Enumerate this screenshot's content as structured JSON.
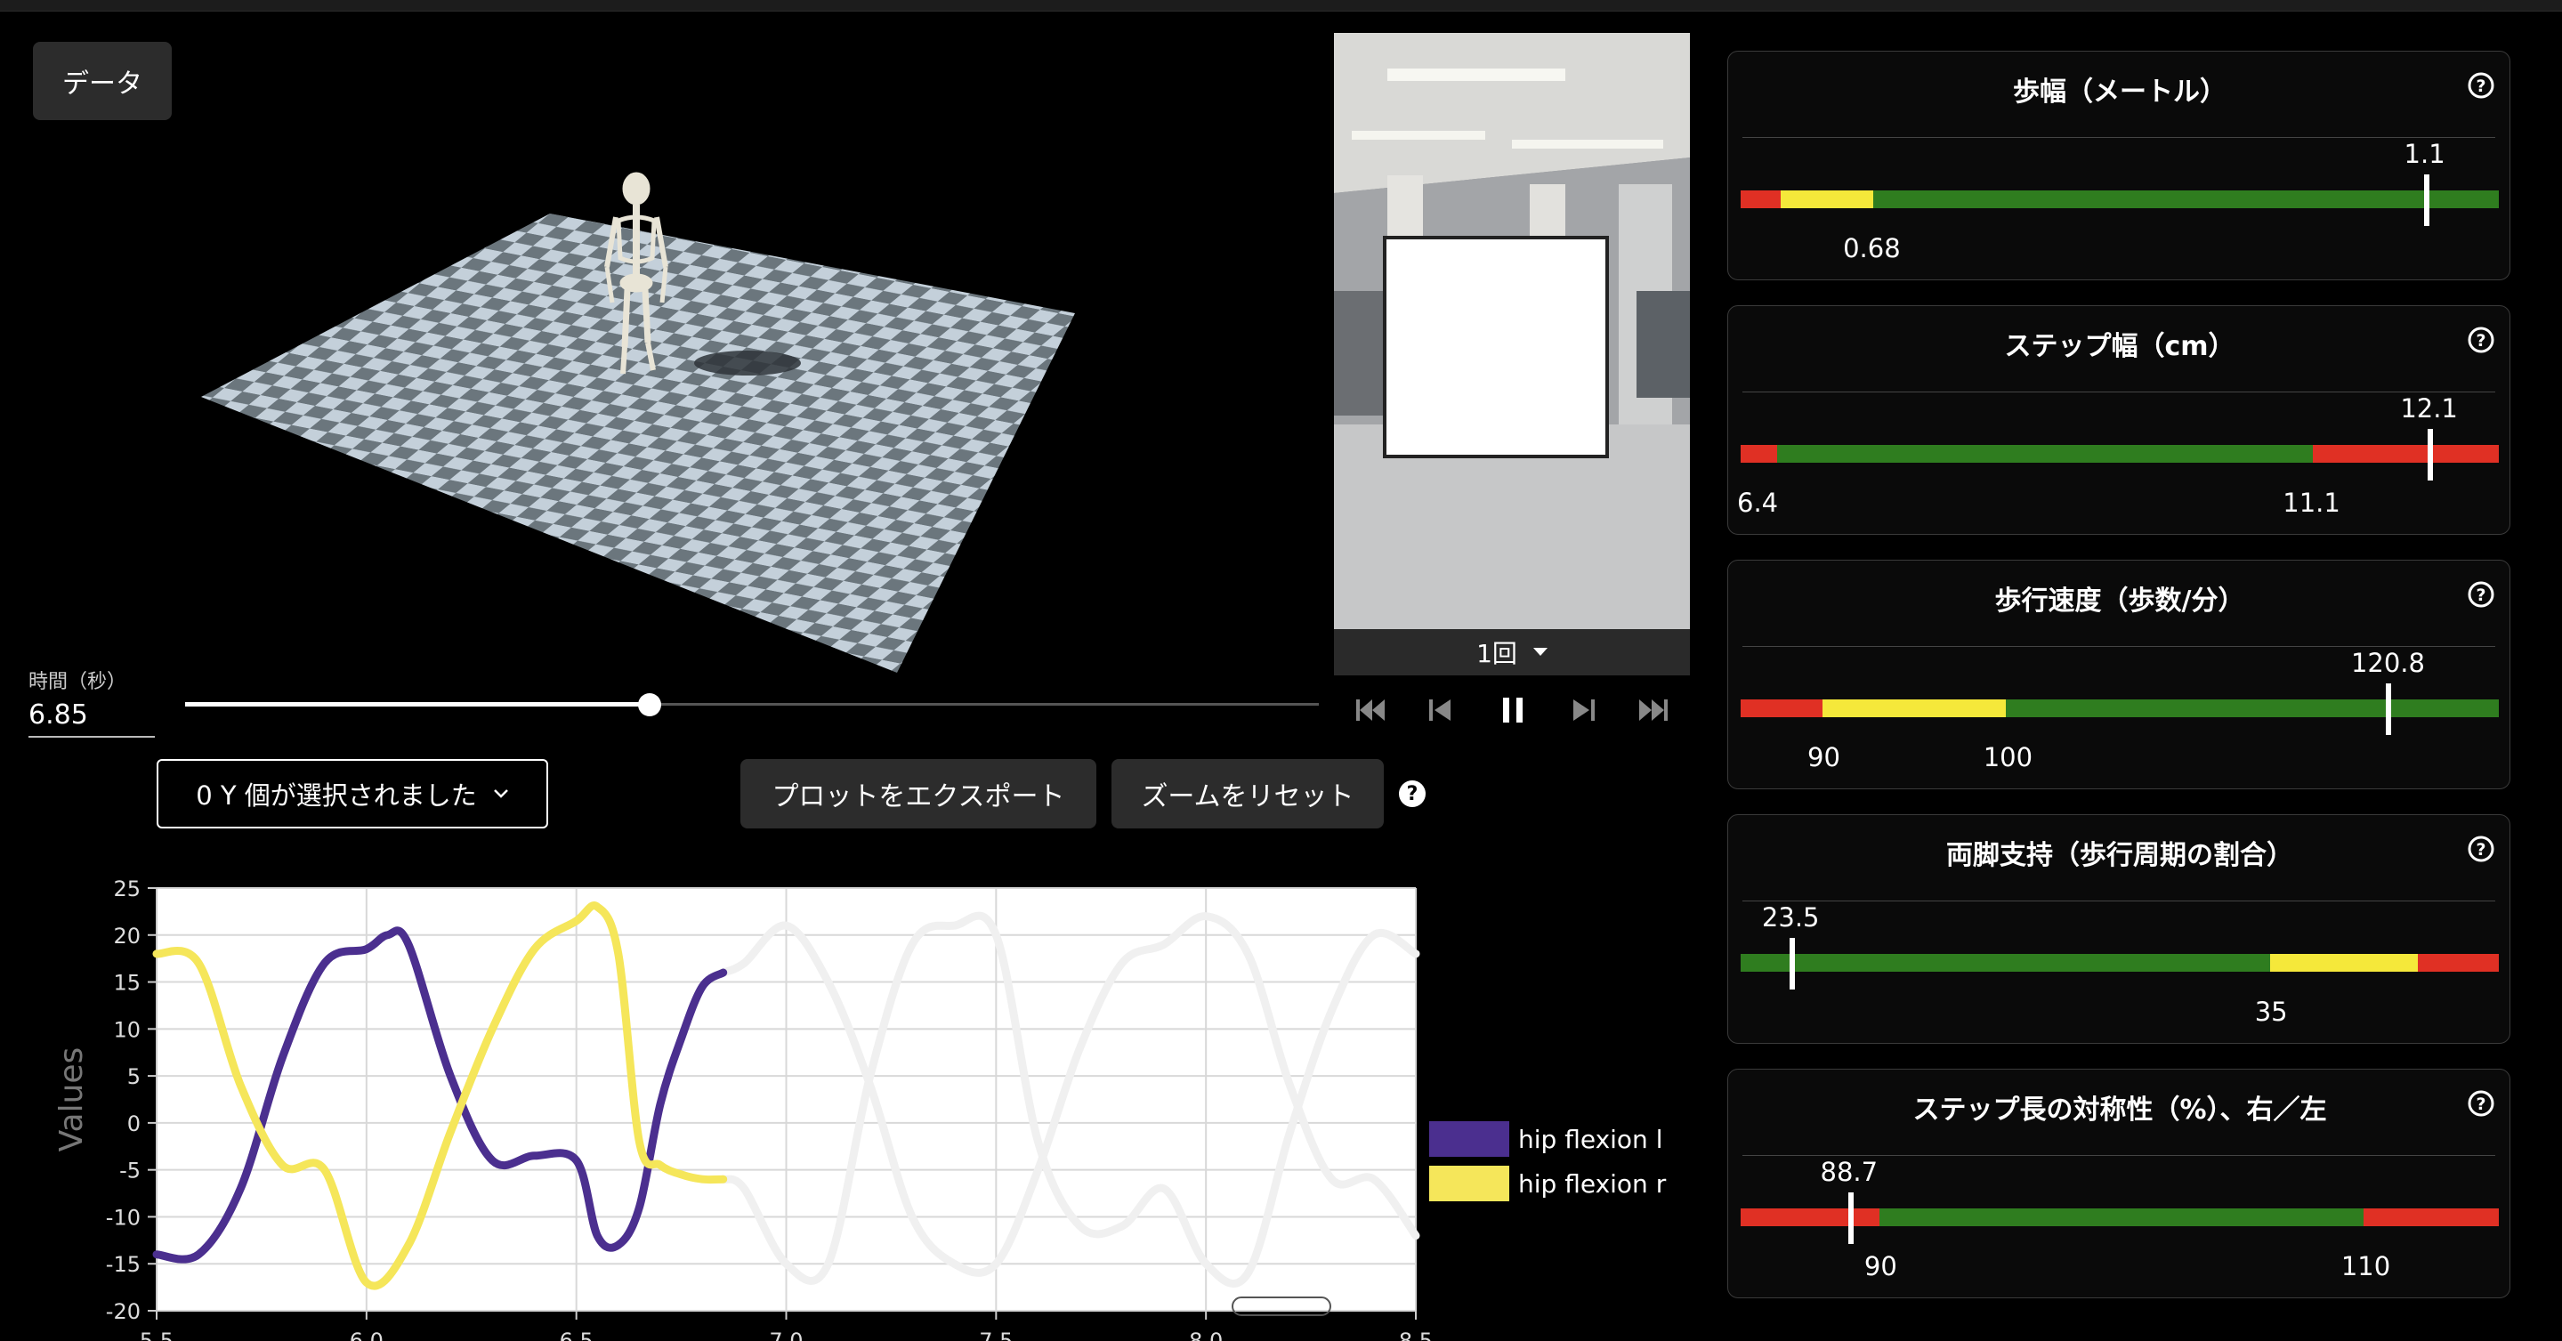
{
  "data_button": "データ",
  "time": {
    "label": "時間（秒）",
    "value": "6.85"
  },
  "playback": {
    "repeat": "1回",
    "progress": 0.41
  },
  "select": {
    "label": "0 Y 個が選択されました"
  },
  "buttons": {
    "export": "プロットをエクスポート",
    "reset_zoom": "ズームをリセット",
    "help": "?"
  },
  "chart_data": {
    "type": "line",
    "ylabel": "Values",
    "xlim": [
      5.5,
      8.5
    ],
    "ylim": [
      -20,
      25
    ],
    "x_ticks": [
      "5.5",
      "6.0",
      "6.5",
      "7.0",
      "7.5",
      "8.0",
      "8.5"
    ],
    "y_ticks": [
      "25",
      "20",
      "15",
      "10",
      "5",
      "0",
      "-5",
      "-10",
      "-15",
      "-20"
    ],
    "current_time": 6.85,
    "series": [
      {
        "name": "hip flexion l",
        "color": "#4b2f8f",
        "x": [
          5.5,
          5.6,
          5.7,
          5.8,
          5.9,
          6.0,
          6.05,
          6.1,
          6.2,
          6.3,
          6.4,
          6.5,
          6.55,
          6.6,
          6.65,
          6.7,
          6.75,
          6.8,
          6.85,
          6.9,
          7.0,
          7.1,
          7.2,
          7.3,
          7.4,
          7.5,
          7.6,
          7.7,
          7.8,
          7.9,
          8.0,
          8.1,
          8.2,
          8.3,
          8.4,
          8.5
        ],
        "y": [
          -14,
          -14,
          -7,
          7,
          17,
          18.5,
          20,
          19,
          5,
          -4,
          -3.5,
          -4,
          -12,
          -13,
          -9,
          2,
          9,
          14.5,
          16,
          17,
          21,
          15,
          4,
          -10,
          -15,
          -15,
          -5,
          8,
          17,
          19,
          22,
          18,
          4,
          -6,
          -6,
          -12
        ]
      },
      {
        "name": "hip flexion r",
        "color": "#f5e65a",
        "x": [
          5.5,
          5.6,
          5.7,
          5.8,
          5.9,
          6.0,
          6.1,
          6.2,
          6.3,
          6.4,
          6.5,
          6.55,
          6.6,
          6.65,
          6.7,
          6.75,
          6.8,
          6.85,
          6.9,
          7.0,
          7.1,
          7.2,
          7.3,
          7.4,
          7.5,
          7.6,
          7.7,
          7.8,
          7.9,
          8.0,
          8.1,
          8.2,
          8.3,
          8.4,
          8.5
        ],
        "y": [
          18,
          17,
          4,
          -4.5,
          -5,
          -17,
          -13,
          -1,
          10,
          18.5,
          21.5,
          23,
          18,
          -2,
          -4.5,
          -5.5,
          -6,
          -6,
          -7,
          -15,
          -15,
          5,
          19,
          21,
          20,
          -2,
          -11,
          -11,
          -7,
          -15,
          -16,
          -1,
          12,
          20,
          18
        ]
      }
    ]
  },
  "metrics": [
    {
      "title": "歩幅（メートル）",
      "current": "1.1",
      "labels": [
        "0.68"
      ],
      "segments": [
        {
          "color": "#e03024",
          "from": 0,
          "to": 0.053
        },
        {
          "color": "#f5e83a",
          "from": 0.053,
          "to": 0.175
        },
        {
          "color": "#2f7d1f",
          "from": 0.175,
          "to": 1
        }
      ],
      "marker": 0.905,
      "label_positions": [
        0.175
      ]
    },
    {
      "title": "ステップ幅（cm）",
      "current": "12.1",
      "labels": [
        "6.4",
        "11.1"
      ],
      "segments": [
        {
          "color": "#e03024",
          "from": 0,
          "to": 0.048
        },
        {
          "color": "#2f7d1f",
          "from": 0.048,
          "to": 0.755
        },
        {
          "color": "#e03024",
          "from": 0.755,
          "to": 1
        }
      ],
      "marker": 0.91,
      "label_positions": [
        0.0,
        0.755
      ]
    },
    {
      "title": "歩行速度（歩数/分）",
      "current": "120.8",
      "labels": [
        "90",
        "100"
      ],
      "segments": [
        {
          "color": "#e03024",
          "from": 0,
          "to": 0.108
        },
        {
          "color": "#f5e83a",
          "from": 0.108,
          "to": 0.35
        },
        {
          "color": "#2f7d1f",
          "from": 0.35,
          "to": 1
        }
      ],
      "marker": 0.855,
      "label_positions": [
        0.108,
        0.35
      ]
    },
    {
      "title": "両脚支持（歩行周期の割合）",
      "current": "23.5",
      "labels": [
        "35"
      ],
      "segments": [
        {
          "color": "#2f7d1f",
          "from": 0,
          "to": 0.698
        },
        {
          "color": "#f5e83a",
          "from": 0.698,
          "to": 0.893
        },
        {
          "color": "#e03024",
          "from": 0.893,
          "to": 1
        }
      ],
      "marker": 0.068,
      "label_positions": [
        0.698
      ]
    },
    {
      "title": "ステップ長の対称性（%）、右／左",
      "current": "88.7",
      "labels": [
        "90",
        "110"
      ],
      "segments": [
        {
          "color": "#e03024",
          "from": 0,
          "to": 0.183
        },
        {
          "color": "#2f7d1f",
          "from": 0.183,
          "to": 0.822
        },
        {
          "color": "#e03024",
          "from": 0.822,
          "to": 1
        }
      ],
      "marker": 0.145,
      "label_positions": [
        0.183,
        0.822
      ]
    }
  ]
}
